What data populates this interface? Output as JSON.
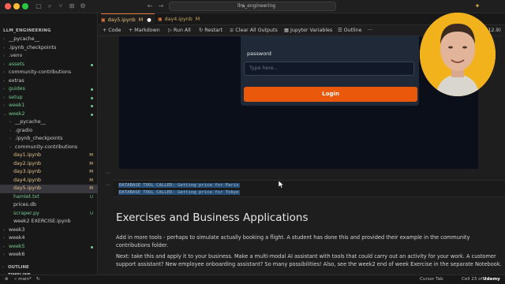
{
  "window": {
    "title": "llm_engineering"
  },
  "tabs": [
    {
      "label": "day5.ipynb",
      "modified": "M"
    },
    {
      "label": "day4.ipynb",
      "modified": "M"
    }
  ],
  "toolbar": {
    "code": "Code",
    "markdown": "Markdown",
    "run_all": "Run All",
    "restart": "Restart",
    "clear_outputs": "Clear All Outputs",
    "variables": "Jupyter Variables",
    "outline": "Outline",
    "more": "···",
    "kernel": "thon 3.12.9)"
  },
  "explorer": {
    "header": "LLM_ENGINEERING",
    "items": [
      {
        "name": "__pycache__",
        "depth": 1,
        "folder": true,
        "badge": ""
      },
      {
        "name": ".ipynb_checkpoints",
        "depth": 1,
        "folder": true,
        "badge": ""
      },
      {
        "name": ".venv",
        "depth": 1,
        "folder": true,
        "badge": ""
      },
      {
        "name": "assets",
        "depth": 1,
        "folder": true,
        "badge": "dot"
      },
      {
        "name": "community-contributions",
        "depth": 1,
        "folder": true,
        "badge": ""
      },
      {
        "name": "extras",
        "depth": 1,
        "folder": true,
        "badge": ""
      },
      {
        "name": "guides",
        "depth": 1,
        "folder": true,
        "badge": "dot"
      },
      {
        "name": "setup",
        "depth": 1,
        "folder": true,
        "badge": "dot"
      },
      {
        "name": "week1",
        "depth": 1,
        "folder": true,
        "badge": "dot"
      },
      {
        "name": "week2",
        "depth": 1,
        "folder": true,
        "badge": "dot",
        "open": true
      },
      {
        "name": "__pycache__",
        "depth": 2,
        "folder": true,
        "badge": ""
      },
      {
        "name": ".gradio",
        "depth": 2,
        "folder": true,
        "badge": ""
      },
      {
        "name": ".ipynb_checkpoints",
        "depth": 2,
        "folder": true,
        "badge": ""
      },
      {
        "name": "community-contributions",
        "depth": 2,
        "folder": true,
        "badge": ""
      },
      {
        "name": "day1.ipynb",
        "depth": 2,
        "folder": false,
        "badge": "M"
      },
      {
        "name": "day2.ipynb",
        "depth": 2,
        "folder": false,
        "badge": "M"
      },
      {
        "name": "day3.ipynb",
        "depth": 2,
        "folder": false,
        "badge": "M"
      },
      {
        "name": "day4.ipynb",
        "depth": 2,
        "folder": false,
        "badge": "M"
      },
      {
        "name": "day5.ipynb",
        "depth": 2,
        "folder": false,
        "badge": "M",
        "selected": true
      },
      {
        "name": "hamlet.txt",
        "depth": 2,
        "folder": false,
        "badge": "U"
      },
      {
        "name": "prices.db",
        "depth": 2,
        "folder": false,
        "badge": ""
      },
      {
        "name": "scraper.py",
        "depth": 2,
        "folder": false,
        "badge": "U"
      },
      {
        "name": "week2 EXERCISE.ipynb",
        "depth": 2,
        "folder": false,
        "badge": ""
      },
      {
        "name": "week3",
        "depth": 1,
        "folder": true,
        "badge": ""
      },
      {
        "name": "week4",
        "depth": 1,
        "folder": true,
        "badge": ""
      },
      {
        "name": "week5",
        "depth": 1,
        "folder": true,
        "badge": "dot"
      },
      {
        "name": "week6",
        "depth": 1,
        "folder": true,
        "badge": ""
      }
    ],
    "outline": "OUTLINE",
    "timeline": "TIMELINE"
  },
  "gradio": {
    "password_label": "password",
    "placeholder": "Type here...",
    "login": "Login"
  },
  "output": {
    "lines": [
      "DATABASE TOOL CALLED: Getting price for Paris",
      "DATABASE TOOL CALLED: Getting price for Tokyo"
    ]
  },
  "markdown": {
    "heading": "Exercises and Business Applications",
    "p1": "Add in more tools - perhaps to simulate actually booking a flight. A student has done this and provided their example in the community contributions folder.",
    "p2": "Next: take this and apply it to your business. Make a multi-modal AI assistant with tools that could carry out an activity for your work. A customer support assistant? New employee onboarding assistant? So many possibilities! Also, see the week2 end of week Exercise in the separate Notebook."
  },
  "status": {
    "branch": "main*",
    "cursor_tab": "Cursor Tab",
    "cell": "Cell 23 of",
    "watermark": "Udemy"
  },
  "colors": {
    "accent": "#ea580c",
    "modified": "#e2c08d",
    "untracked": "#73c991"
  }
}
